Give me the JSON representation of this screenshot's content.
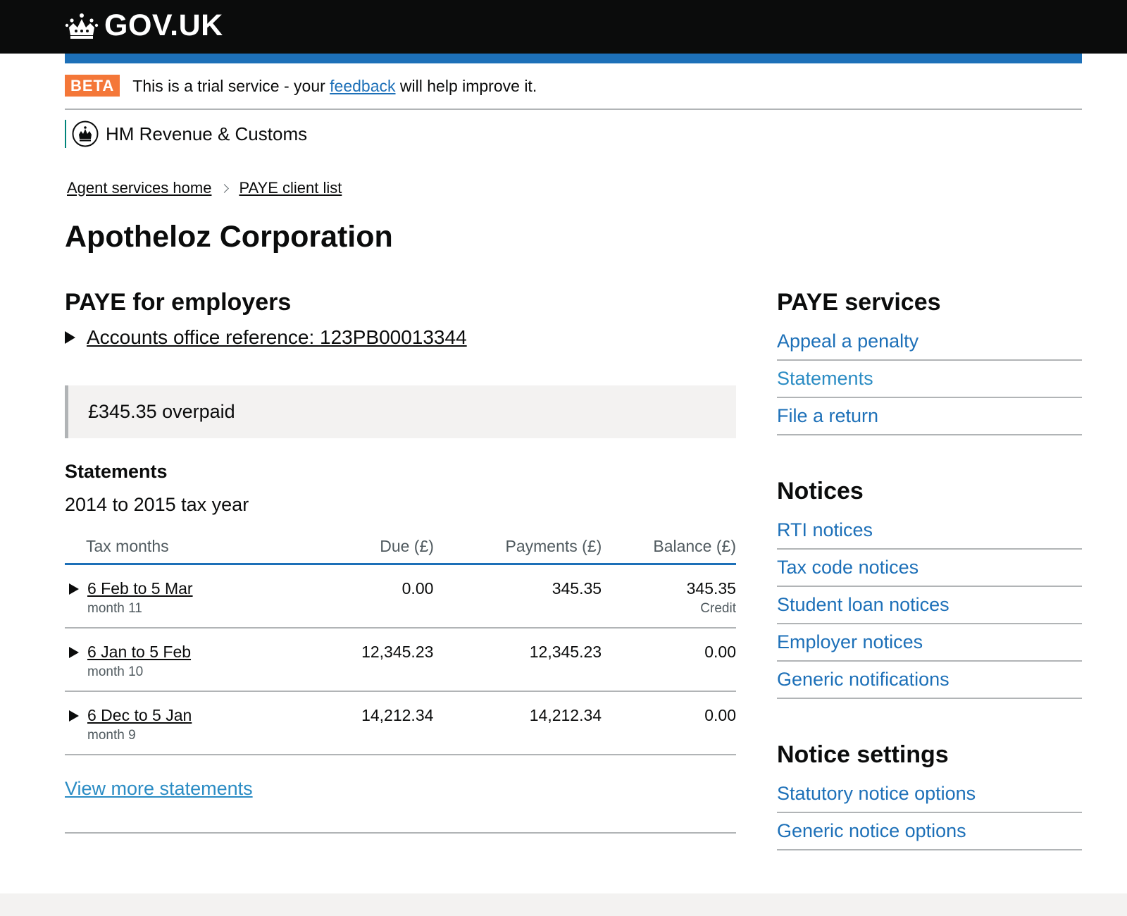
{
  "header": {
    "brand": "GOV.UK"
  },
  "phase_banner": {
    "tag": "BETA",
    "text_before": "This is a trial service - your ",
    "link": "feedback",
    "text_after": " will help improve it."
  },
  "organisation": {
    "name": "HM Revenue & Customs"
  },
  "breadcrumbs": [
    {
      "label": "Agent services home"
    },
    {
      "label": "PAYE client list"
    }
  ],
  "page_title": "Apotheloz Corporation",
  "paye": {
    "heading": "PAYE for employers",
    "reference": "Accounts office reference: 123PB00013344",
    "balance": "£345.35 overpaid"
  },
  "statements": {
    "heading": "Statements",
    "tax_year": "2014 to 2015 tax year",
    "columns": [
      "Tax months",
      "Due (£)",
      "Payments (£)",
      "Balance (£)"
    ],
    "rows": [
      {
        "period": "6 Feb to 5 Mar",
        "month": "month 11",
        "due": "0.00",
        "payments": "345.35",
        "balance": "345.35",
        "balance_note": "Credit"
      },
      {
        "period": "6 Jan to 5 Feb",
        "month": "month 10",
        "due": "12,345.23",
        "payments": "12,345.23",
        "balance": "0.00",
        "balance_note": ""
      },
      {
        "period": "6 Dec to 5 Jan",
        "month": "month 9",
        "due": "14,212.34",
        "payments": "14,212.34",
        "balance": "0.00",
        "balance_note": ""
      }
    ],
    "view_more": "View more statements"
  },
  "sidebar": {
    "paye_services": {
      "heading": "PAYE services",
      "items": [
        "Appeal a penalty",
        "Statements",
        "File a return"
      ]
    },
    "notices": {
      "heading": "Notices",
      "items": [
        "RTI notices",
        "Tax code notices",
        "Student loan notices",
        "Employer notices",
        "Generic notifications"
      ]
    },
    "notice_settings": {
      "heading": "Notice settings",
      "items": [
        "Statutory notice options",
        "Generic notice options"
      ]
    }
  },
  "colors": {
    "header_bg": "#0b0c0c",
    "brand_blue": "#1d70b8",
    "beta_tag": "#f47738",
    "link_light": "#2b8cc4",
    "org_accent": "#00847a"
  }
}
